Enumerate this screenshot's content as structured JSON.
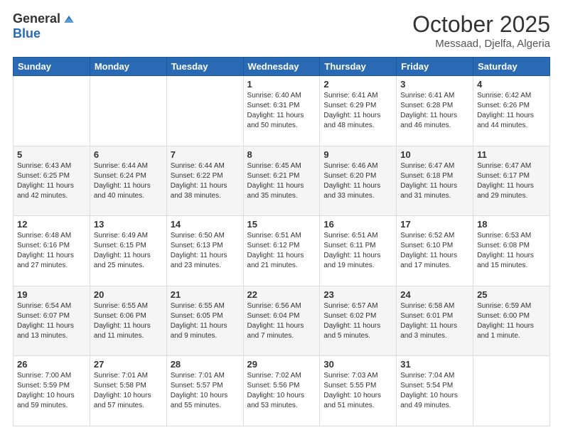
{
  "logo": {
    "general": "General",
    "blue": "Blue"
  },
  "title": "October 2025",
  "location": "Messaad, Djelfa, Algeria",
  "days_of_week": [
    "Sunday",
    "Monday",
    "Tuesday",
    "Wednesday",
    "Thursday",
    "Friday",
    "Saturday"
  ],
  "weeks": [
    [
      {
        "day": "",
        "sunrise": "",
        "sunset": "",
        "daylight": ""
      },
      {
        "day": "",
        "sunrise": "",
        "sunset": "",
        "daylight": ""
      },
      {
        "day": "",
        "sunrise": "",
        "sunset": "",
        "daylight": ""
      },
      {
        "day": "1",
        "sunrise": "Sunrise: 6:40 AM",
        "sunset": "Sunset: 6:31 PM",
        "daylight": "Daylight: 11 hours and 50 minutes."
      },
      {
        "day": "2",
        "sunrise": "Sunrise: 6:41 AM",
        "sunset": "Sunset: 6:29 PM",
        "daylight": "Daylight: 11 hours and 48 minutes."
      },
      {
        "day": "3",
        "sunrise": "Sunrise: 6:41 AM",
        "sunset": "Sunset: 6:28 PM",
        "daylight": "Daylight: 11 hours and 46 minutes."
      },
      {
        "day": "4",
        "sunrise": "Sunrise: 6:42 AM",
        "sunset": "Sunset: 6:26 PM",
        "daylight": "Daylight: 11 hours and 44 minutes."
      }
    ],
    [
      {
        "day": "5",
        "sunrise": "Sunrise: 6:43 AM",
        "sunset": "Sunset: 6:25 PM",
        "daylight": "Daylight: 11 hours and 42 minutes."
      },
      {
        "day": "6",
        "sunrise": "Sunrise: 6:44 AM",
        "sunset": "Sunset: 6:24 PM",
        "daylight": "Daylight: 11 hours and 40 minutes."
      },
      {
        "day": "7",
        "sunrise": "Sunrise: 6:44 AM",
        "sunset": "Sunset: 6:22 PM",
        "daylight": "Daylight: 11 hours and 38 minutes."
      },
      {
        "day": "8",
        "sunrise": "Sunrise: 6:45 AM",
        "sunset": "Sunset: 6:21 PM",
        "daylight": "Daylight: 11 hours and 35 minutes."
      },
      {
        "day": "9",
        "sunrise": "Sunrise: 6:46 AM",
        "sunset": "Sunset: 6:20 PM",
        "daylight": "Daylight: 11 hours and 33 minutes."
      },
      {
        "day": "10",
        "sunrise": "Sunrise: 6:47 AM",
        "sunset": "Sunset: 6:18 PM",
        "daylight": "Daylight: 11 hours and 31 minutes."
      },
      {
        "day": "11",
        "sunrise": "Sunrise: 6:47 AM",
        "sunset": "Sunset: 6:17 PM",
        "daylight": "Daylight: 11 hours and 29 minutes."
      }
    ],
    [
      {
        "day": "12",
        "sunrise": "Sunrise: 6:48 AM",
        "sunset": "Sunset: 6:16 PM",
        "daylight": "Daylight: 11 hours and 27 minutes."
      },
      {
        "day": "13",
        "sunrise": "Sunrise: 6:49 AM",
        "sunset": "Sunset: 6:15 PM",
        "daylight": "Daylight: 11 hours and 25 minutes."
      },
      {
        "day": "14",
        "sunrise": "Sunrise: 6:50 AM",
        "sunset": "Sunset: 6:13 PM",
        "daylight": "Daylight: 11 hours and 23 minutes."
      },
      {
        "day": "15",
        "sunrise": "Sunrise: 6:51 AM",
        "sunset": "Sunset: 6:12 PM",
        "daylight": "Daylight: 11 hours and 21 minutes."
      },
      {
        "day": "16",
        "sunrise": "Sunrise: 6:51 AM",
        "sunset": "Sunset: 6:11 PM",
        "daylight": "Daylight: 11 hours and 19 minutes."
      },
      {
        "day": "17",
        "sunrise": "Sunrise: 6:52 AM",
        "sunset": "Sunset: 6:10 PM",
        "daylight": "Daylight: 11 hours and 17 minutes."
      },
      {
        "day": "18",
        "sunrise": "Sunrise: 6:53 AM",
        "sunset": "Sunset: 6:08 PM",
        "daylight": "Daylight: 11 hours and 15 minutes."
      }
    ],
    [
      {
        "day": "19",
        "sunrise": "Sunrise: 6:54 AM",
        "sunset": "Sunset: 6:07 PM",
        "daylight": "Daylight: 11 hours and 13 minutes."
      },
      {
        "day": "20",
        "sunrise": "Sunrise: 6:55 AM",
        "sunset": "Sunset: 6:06 PM",
        "daylight": "Daylight: 11 hours and 11 minutes."
      },
      {
        "day": "21",
        "sunrise": "Sunrise: 6:55 AM",
        "sunset": "Sunset: 6:05 PM",
        "daylight": "Daylight: 11 hours and 9 minutes."
      },
      {
        "day": "22",
        "sunrise": "Sunrise: 6:56 AM",
        "sunset": "Sunset: 6:04 PM",
        "daylight": "Daylight: 11 hours and 7 minutes."
      },
      {
        "day": "23",
        "sunrise": "Sunrise: 6:57 AM",
        "sunset": "Sunset: 6:02 PM",
        "daylight": "Daylight: 11 hours and 5 minutes."
      },
      {
        "day": "24",
        "sunrise": "Sunrise: 6:58 AM",
        "sunset": "Sunset: 6:01 PM",
        "daylight": "Daylight: 11 hours and 3 minutes."
      },
      {
        "day": "25",
        "sunrise": "Sunrise: 6:59 AM",
        "sunset": "Sunset: 6:00 PM",
        "daylight": "Daylight: 11 hours and 1 minute."
      }
    ],
    [
      {
        "day": "26",
        "sunrise": "Sunrise: 7:00 AM",
        "sunset": "Sunset: 5:59 PM",
        "daylight": "Daylight: 10 hours and 59 minutes."
      },
      {
        "day": "27",
        "sunrise": "Sunrise: 7:01 AM",
        "sunset": "Sunset: 5:58 PM",
        "daylight": "Daylight: 10 hours and 57 minutes."
      },
      {
        "day": "28",
        "sunrise": "Sunrise: 7:01 AM",
        "sunset": "Sunset: 5:57 PM",
        "daylight": "Daylight: 10 hours and 55 minutes."
      },
      {
        "day": "29",
        "sunrise": "Sunrise: 7:02 AM",
        "sunset": "Sunset: 5:56 PM",
        "daylight": "Daylight: 10 hours and 53 minutes."
      },
      {
        "day": "30",
        "sunrise": "Sunrise: 7:03 AM",
        "sunset": "Sunset: 5:55 PM",
        "daylight": "Daylight: 10 hours and 51 minutes."
      },
      {
        "day": "31",
        "sunrise": "Sunrise: 7:04 AM",
        "sunset": "Sunset: 5:54 PM",
        "daylight": "Daylight: 10 hours and 49 minutes."
      },
      {
        "day": "",
        "sunrise": "",
        "sunset": "",
        "daylight": ""
      }
    ]
  ]
}
